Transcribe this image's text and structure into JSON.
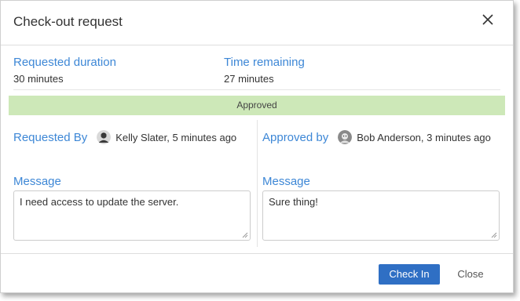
{
  "dialog": {
    "title": "Check-out request",
    "close_icon": "close-x-icon"
  },
  "details": {
    "requested_duration_label": "Requested duration",
    "requested_duration_value": "30 minutes",
    "time_remaining_label": "Time remaining",
    "time_remaining_value": "27 minutes"
  },
  "status": {
    "text": "Approved",
    "color": "#cde8b8"
  },
  "requested": {
    "label": "Requested By",
    "name": "Kelly Slater, 5 minutes ago",
    "message_label": "Message",
    "message": "I need access to update the server."
  },
  "approved": {
    "label": "Approved by",
    "name": "Bob Anderson, 3 minutes ago",
    "message_label": "Message",
    "message": "Sure thing!"
  },
  "actions": {
    "check_in_label": "Check In",
    "close_label": "Close",
    "accent_color": "#2f6fc4"
  }
}
